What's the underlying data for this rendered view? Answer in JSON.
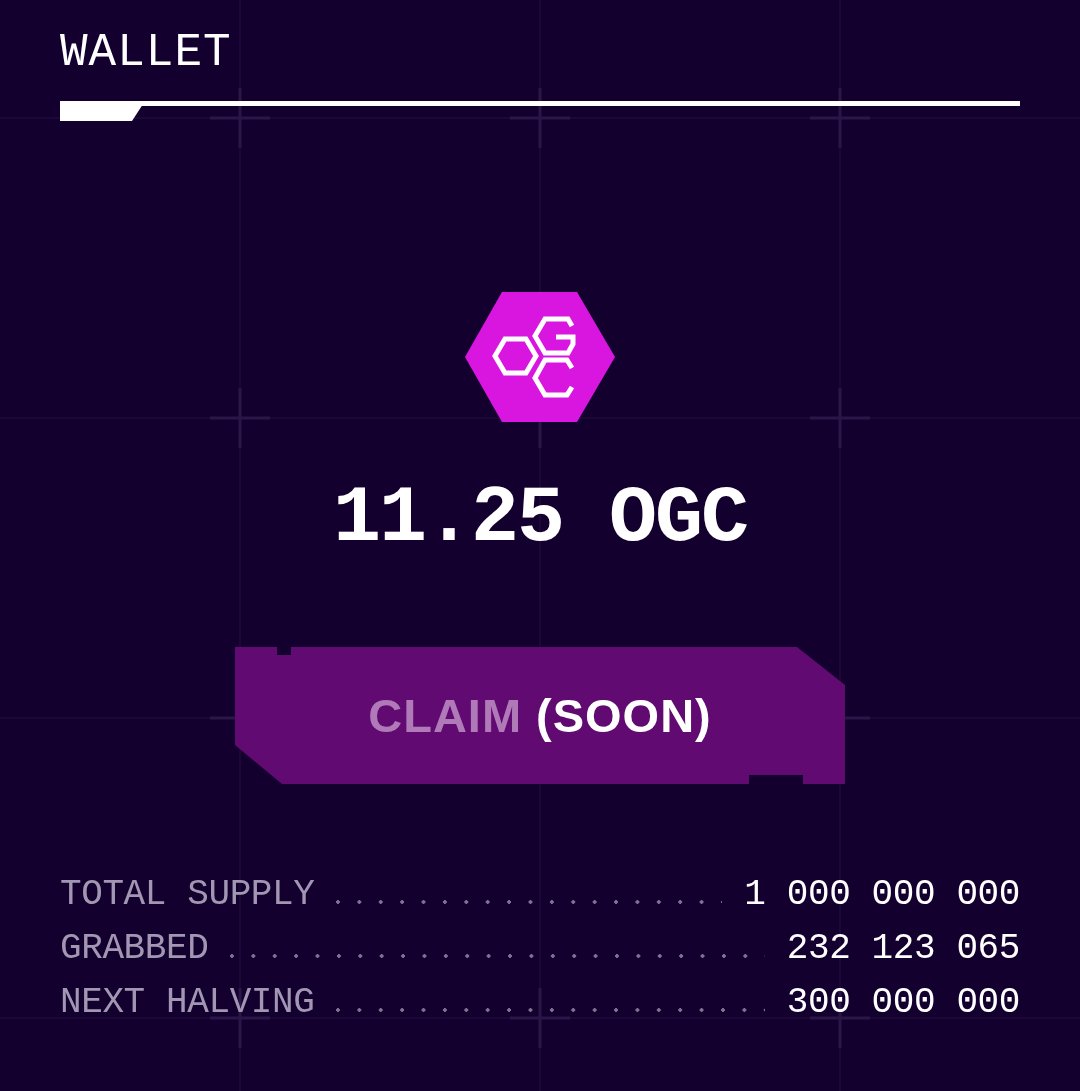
{
  "header": {
    "title": "WALLET"
  },
  "balance": {
    "amount": "11.25 OGC"
  },
  "claim_button": {
    "label": "CLAIM",
    "note": "(SOON)",
    "disabled": true
  },
  "stats": [
    {
      "label": "TOTAL SUPPLY",
      "value": "1 000 000 000"
    },
    {
      "label": "GRABBED",
      "value": "232 123 065"
    },
    {
      "label": "NEXT HALVING",
      "value": "300 000 000"
    }
  ]
}
